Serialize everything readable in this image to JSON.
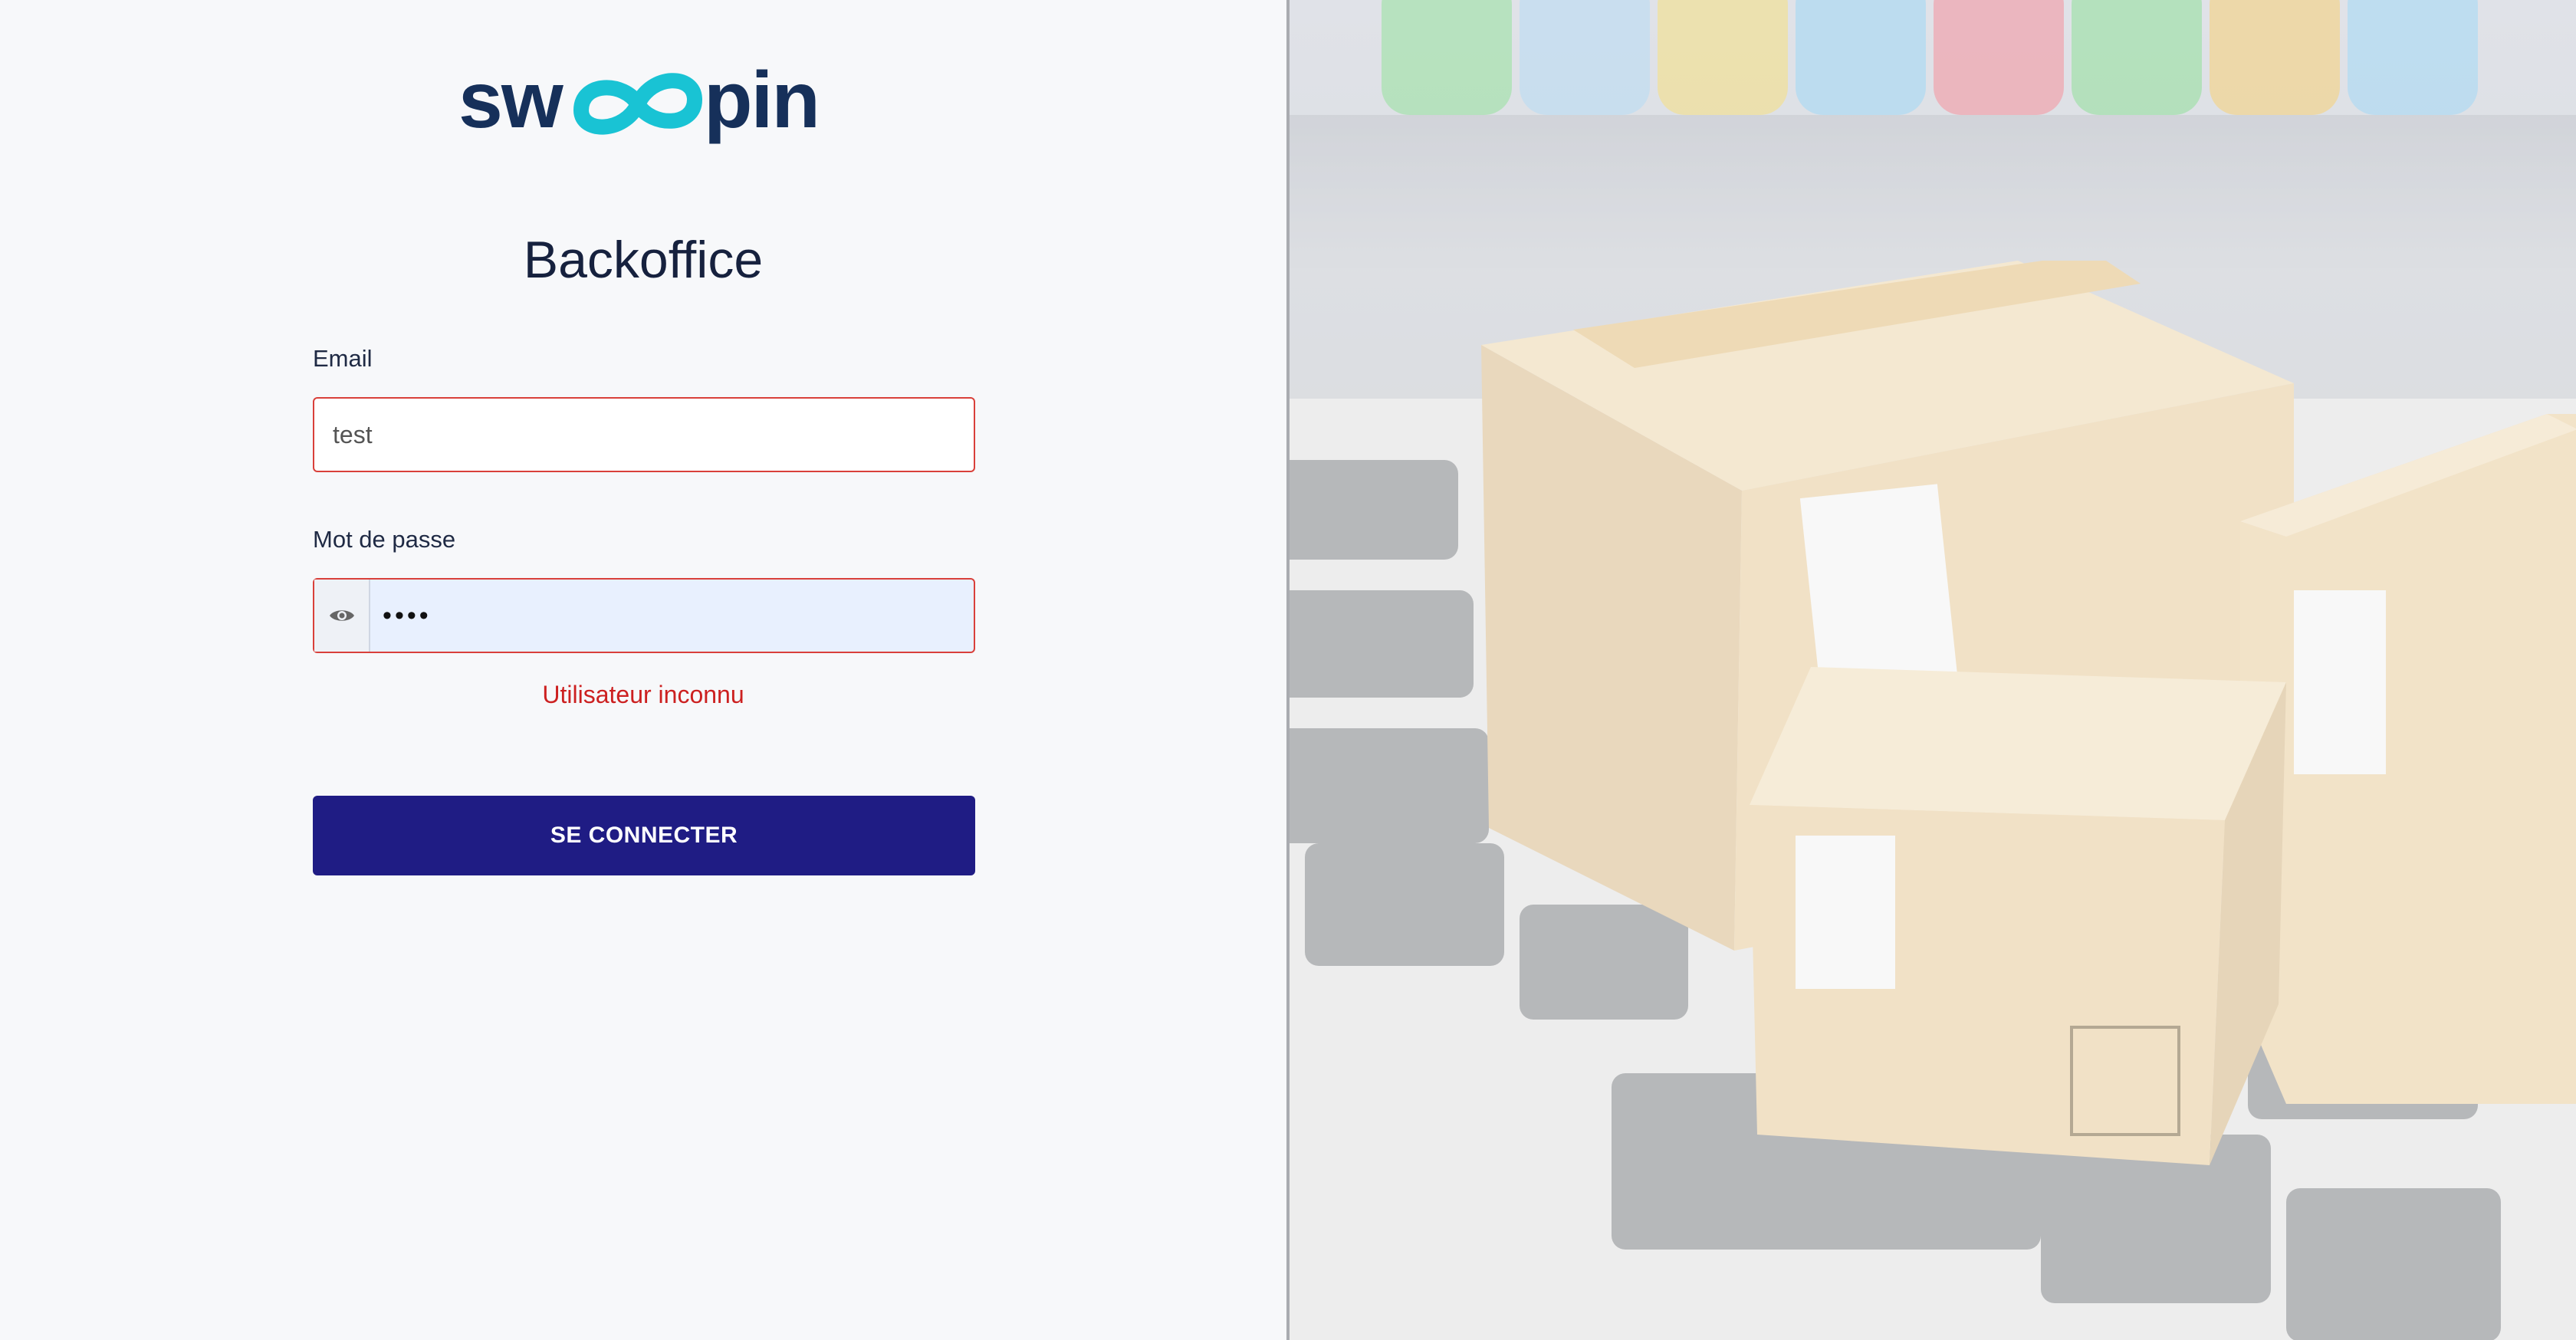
{
  "brand": {
    "logo_text": "swoopin",
    "logo_dark": "#16305a",
    "logo_accent": "#19c3d4"
  },
  "page": {
    "title": "Backoffice"
  },
  "form": {
    "email_label": "Email",
    "email_value": "test",
    "password_label": "Mot de passe",
    "password_value": "••••",
    "error_message": "Utilisateur inconnu",
    "submit_label": "SE CONNECTER"
  },
  "colors": {
    "error": "#cc2020",
    "button": "#1f1c84",
    "field_error_border": "#d9403a",
    "autofill_bg": "#e8f0fe"
  },
  "icons": {
    "password_toggle": "eye-icon"
  },
  "hero_image": {
    "description_icons": [
      "cardboard-box",
      "keyboard"
    ]
  }
}
